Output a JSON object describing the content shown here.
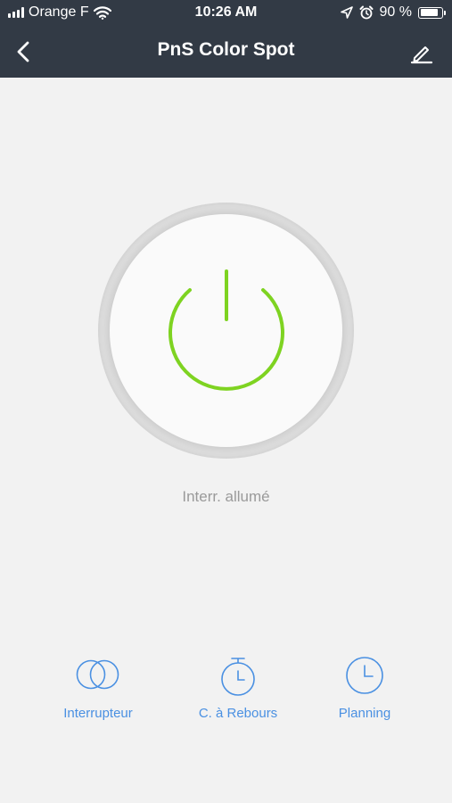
{
  "status_bar": {
    "carrier": "Orange F",
    "time": "10:26 AM",
    "battery_text": "90 %",
    "battery_level": 0.9
  },
  "nav": {
    "title": "PnS Color Spot",
    "back_icon": "chevron-left-icon",
    "edit_icon": "pencil-icon"
  },
  "power": {
    "state_text": "Interr. allumé",
    "icon": "power-icon",
    "accent_color": "#7ed321"
  },
  "actions": [
    {
      "label": "Interrupteur",
      "icon": "toggle-circles-icon"
    },
    {
      "label": "C. à Rebours",
      "icon": "stopwatch-icon"
    },
    {
      "label": "Planning",
      "icon": "clock-icon"
    }
  ],
  "colors": {
    "header_bg": "#323a45",
    "page_bg": "#f2f2f2",
    "action_blue": "#4a90e2",
    "status_gray": "#9a9a9a"
  }
}
